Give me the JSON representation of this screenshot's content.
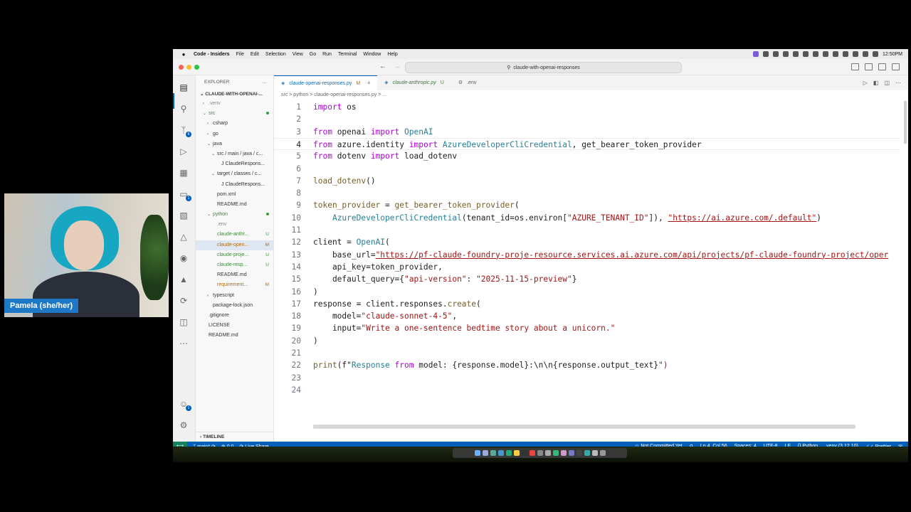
{
  "menubar": {
    "app": "Code - Insiders",
    "items": [
      "File",
      "Edit",
      "Selection",
      "View",
      "Go",
      "Run",
      "Terminal",
      "Window",
      "Help"
    ],
    "clock": "12:50PM"
  },
  "titlebar": {
    "search": "claude-with-openai-responses"
  },
  "sidebar": {
    "title": "EXPLORER",
    "more": "...",
    "root": "CLAUDE-WITH-OPENAI-...",
    "tree": [
      {
        "label": ".venv",
        "indent": 1,
        "chev": ">",
        "color": "gray",
        "status": ""
      },
      {
        "label": "src",
        "indent": 1,
        "chev": "v",
        "color": "green",
        "status": "dot"
      },
      {
        "label": "csharp",
        "indent": 2,
        "chev": ">",
        "color": "",
        "status": ""
      },
      {
        "label": "go",
        "indent": 2,
        "chev": ">",
        "color": "",
        "status": ""
      },
      {
        "label": "java",
        "indent": 2,
        "chev": "v",
        "color": "",
        "status": ""
      },
      {
        "label": "src / main / java / c...",
        "indent": 3,
        "chev": "v",
        "color": "",
        "status": ""
      },
      {
        "label": "J  ClaudeRespons...",
        "indent": 4,
        "chev": "",
        "color": "",
        "status": ""
      },
      {
        "label": "target / classes / c...",
        "indent": 3,
        "chev": "v",
        "color": "",
        "status": ""
      },
      {
        "label": "J  ClaudeRespons...",
        "indent": 4,
        "chev": "",
        "color": "",
        "status": ""
      },
      {
        "label": "pom.xml",
        "indent": 3,
        "chev": "",
        "color": "",
        "status": ""
      },
      {
        "label": "README.md",
        "indent": 3,
        "chev": "",
        "color": "",
        "status": ""
      },
      {
        "label": "python",
        "indent": 2,
        "chev": "v",
        "color": "green",
        "status": "dot"
      },
      {
        "label": ".env",
        "indent": 3,
        "chev": "",
        "color": "gray",
        "status": ""
      },
      {
        "label": "claude-anthr...",
        "indent": 3,
        "chev": "",
        "color": "green",
        "status": "U"
      },
      {
        "label": "claude-open...",
        "indent": 3,
        "chev": "",
        "color": "orange",
        "status": "M",
        "selected": true
      },
      {
        "label": "claude-proje...",
        "indent": 3,
        "chev": "",
        "color": "green",
        "status": "U"
      },
      {
        "label": "claude-resp...",
        "indent": 3,
        "chev": "",
        "color": "green",
        "status": "U"
      },
      {
        "label": "README.md",
        "indent": 3,
        "chev": "",
        "color": "",
        "status": ""
      },
      {
        "label": "requirement...",
        "indent": 3,
        "chev": "",
        "color": "orange",
        "status": "M"
      },
      {
        "label": "typescript",
        "indent": 2,
        "chev": ">",
        "color": "",
        "status": ""
      },
      {
        "label": "package-lock.json",
        "indent": 2,
        "chev": "",
        "color": "",
        "status": ""
      },
      {
        "label": ".gitignore",
        "indent": 1,
        "chev": "",
        "color": "",
        "status": ""
      },
      {
        "label": "LICENSE",
        "indent": 1,
        "chev": "",
        "color": "",
        "status": ""
      },
      {
        "label": "README.md",
        "indent": 1,
        "chev": "",
        "color": "",
        "status": ""
      }
    ],
    "timeline": "TIMELINE"
  },
  "tabs": [
    {
      "name": "claude-openai-responses.py",
      "status": "M",
      "active": true
    },
    {
      "name": "claude-anthropic.py",
      "status": "U",
      "active": false
    },
    {
      "name": ".env",
      "status": "",
      "active": false
    }
  ],
  "breadcrumb": "src > python > claude-openai-responses.py > ...",
  "code": {
    "current_line": 4,
    "lines": [
      "import os",
      "",
      "from openai import OpenAI",
      "from azure.identity import AzureDeveloperCliCredential, get_bearer_token_provider",
      "from dotenv import load_dotenv",
      "",
      "load_dotenv()",
      "",
      "token_provider = get_bearer_token_provider(",
      "    AzureDeveloperCliCredential(tenant_id=os.environ[\"AZURE_TENANT_ID\"]), \"https://ai.azure.com/.default\")",
      "",
      "client = OpenAI(",
      "    base_url=\"https://pf-claude-foundry-proje-resource.services.ai.azure.com/api/projects/pf-claude-foundry-project/oper",
      "    api_key=token_provider,",
      "    default_query={\"api-version\": \"2025-11-15-preview\"}",
      ")",
      "response = client.responses.create(",
      "    model=\"claude-sonnet-4-5\",",
      "    input=\"Write a one-sentence bedtime story about a unicorn.\"",
      ")",
      "",
      "print(f\"Response from model: {response.model}:\\n\\n{response.output_text}\")",
      "",
      ""
    ]
  },
  "statusbar": {
    "branch": "main*",
    "problems": "0  0",
    "liveshare": "Live Share",
    "commit": "Not Committed Yet",
    "position": "Ln 4, Col 56",
    "spaces": "Spaces: 4",
    "encoding": "UTF-8",
    "eol": "LF",
    "language": "Python",
    "interpreter": ".venv (3.12.10)",
    "formatter": "Prettier"
  },
  "webcam": {
    "name": "Pamela (she/her)"
  },
  "colors": {
    "accent": "#005fb8",
    "statusbar": "#005fb8",
    "keyword": "#af00db",
    "string": "#a31515",
    "name_tag": "#1d78c8"
  }
}
